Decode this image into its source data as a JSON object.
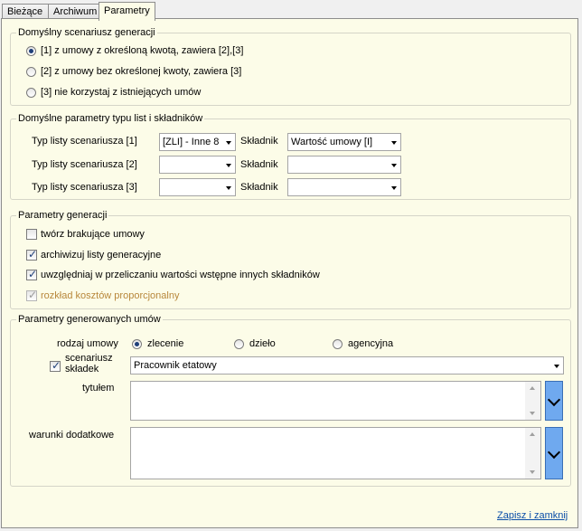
{
  "tabs": [
    {
      "label": "Bieżące",
      "active": false
    },
    {
      "label": "Archiwum",
      "active": false
    },
    {
      "label": "Parametry",
      "active": true
    }
  ],
  "scenario_group": {
    "title": "Domyślny scenariusz generacji",
    "options": [
      {
        "label": "[1] z umowy z określoną kwotą, zawiera [2],[3]",
        "selected": true
      },
      {
        "label": "[2] z umowy bez określonej kwoty, zawiera [3]",
        "selected": false
      },
      {
        "label": "[3] nie korzystaj  z istniejących umów",
        "selected": false
      }
    ]
  },
  "params_group": {
    "title": "Domyślne parametry typu list i składników",
    "rows": [
      {
        "type_label": "Typ listy scenariusza [1]",
        "type_value": "[ZLI] - Inne 8",
        "comp_label": "Składnik",
        "comp_value": "Wartość umowy [I]"
      },
      {
        "type_label": "Typ listy scenariusza [2]",
        "type_value": "",
        "comp_label": "Składnik",
        "comp_value": ""
      },
      {
        "type_label": "Typ listy scenariusza [3]",
        "type_value": "",
        "comp_label": "Składnik",
        "comp_value": ""
      }
    ]
  },
  "gen_group": {
    "title": "Parametry generacji",
    "items": [
      {
        "label": "twórz brakujące umowy",
        "checked": false,
        "disabled": false
      },
      {
        "label": "archiwizuj listy generacyjne",
        "checked": true,
        "disabled": false
      },
      {
        "label": "uwzględniaj w przeliczaniu wartości wstępne innych składników",
        "checked": true,
        "disabled": false
      },
      {
        "label": "rozkład kosztów proporcjonalny",
        "checked": true,
        "disabled": true
      }
    ]
  },
  "contract_group": {
    "title": "Parametry generowanych umów",
    "type_label": "rodzaj umowy",
    "type_options": [
      {
        "label": "zlecenie",
        "selected": true
      },
      {
        "label": "dzieło",
        "selected": false
      },
      {
        "label": "agencyjna",
        "selected": false
      }
    ],
    "scenario_check_label_1": "scenariusz",
    "scenario_check_label_2": "składek",
    "scenario_checked": true,
    "scenario_value": "Pracownik etatowy",
    "title_label": "tytułem",
    "title_value": "",
    "conditions_label": "warunki dodatkowe",
    "conditions_value": ""
  },
  "footer": {
    "save_close": "Zapisz i zamknij"
  }
}
